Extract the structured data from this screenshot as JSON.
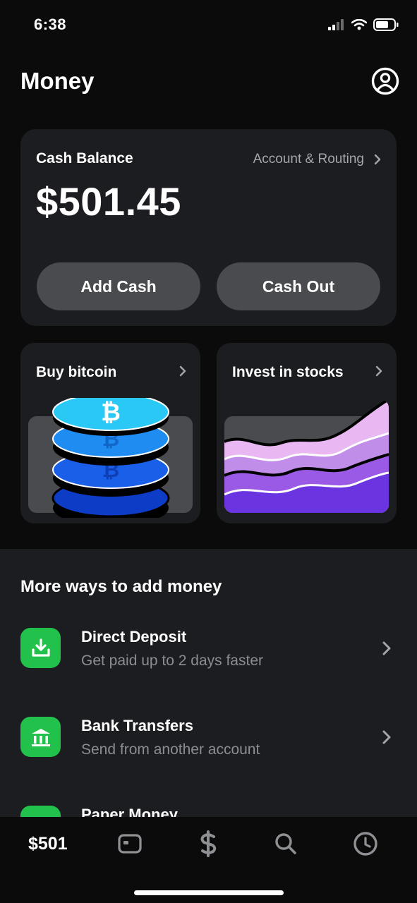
{
  "status_bar": {
    "time": "6:38"
  },
  "header": {
    "title": "Money"
  },
  "balance_card": {
    "label": "Cash Balance",
    "account_link": "Account & Routing",
    "amount": "$501.45",
    "add_cash": "Add Cash",
    "cash_out": "Cash Out"
  },
  "promos": [
    {
      "title": "Buy bitcoin"
    },
    {
      "title": "Invest in stocks"
    }
  ],
  "more_ways": {
    "title": "More ways to add money",
    "items": [
      {
        "title": "Direct Deposit",
        "subtitle": "Get paid up to 2 days faster",
        "icon": "download-tray-icon"
      },
      {
        "title": "Bank Transfers",
        "subtitle": "Send from another account",
        "icon": "bank-icon"
      },
      {
        "title": "Paper Money",
        "icon": "paper-money-icon"
      }
    ]
  },
  "tab_bar": {
    "balance_label": "$501",
    "icons": [
      "card-icon",
      "dollar-icon",
      "search-icon",
      "activity-clock-icon"
    ]
  },
  "colors": {
    "background": "#0b0b0c",
    "card": "#1c1d20",
    "pill": "#4a4b4f",
    "accent_green": "#22c14b",
    "muted_text": "#8c8d92"
  }
}
